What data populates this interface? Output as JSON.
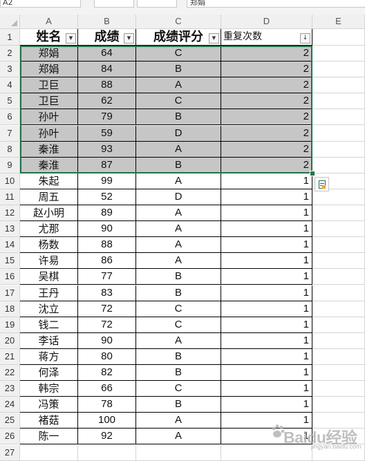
{
  "formula_bar": {
    "name_box": "A2",
    "formula": "郑娟"
  },
  "columns": [
    "A",
    "B",
    "C",
    "D",
    "E"
  ],
  "header": {
    "name": "姓名",
    "score": "成绩",
    "grade": "成绩评分",
    "repeat": "重复次数"
  },
  "rows": [
    {
      "n": "1"
    },
    {
      "n": "2",
      "name": "郑娟",
      "score": "64",
      "grade": "C",
      "repeat": "2"
    },
    {
      "n": "3",
      "name": "郑娟",
      "score": "84",
      "grade": "B",
      "repeat": "2"
    },
    {
      "n": "4",
      "name": "卫巨",
      "score": "88",
      "grade": "A",
      "repeat": "2"
    },
    {
      "n": "5",
      "name": "卫巨",
      "score": "62",
      "grade": "C",
      "repeat": "2"
    },
    {
      "n": "6",
      "name": "孙叶",
      "score": "79",
      "grade": "B",
      "repeat": "2"
    },
    {
      "n": "7",
      "name": "孙叶",
      "score": "59",
      "grade": "D",
      "repeat": "2"
    },
    {
      "n": "8",
      "name": "秦淮",
      "score": "93",
      "grade": "A",
      "repeat": "2"
    },
    {
      "n": "9",
      "name": "秦淮",
      "score": "87",
      "grade": "B",
      "repeat": "2"
    },
    {
      "n": "10",
      "name": "朱起",
      "score": "99",
      "grade": "A",
      "repeat": "1"
    },
    {
      "n": "11",
      "name": "周五",
      "score": "52",
      "grade": "D",
      "repeat": "1"
    },
    {
      "n": "12",
      "name": "赵小明",
      "score": "89",
      "grade": "A",
      "repeat": "1"
    },
    {
      "n": "13",
      "name": "尤那",
      "score": "90",
      "grade": "A",
      "repeat": "1"
    },
    {
      "n": "14",
      "name": "杨数",
      "score": "88",
      "grade": "A",
      "repeat": "1"
    },
    {
      "n": "15",
      "name": "许易",
      "score": "86",
      "grade": "A",
      "repeat": "1"
    },
    {
      "n": "16",
      "name": "吴棋",
      "score": "77",
      "grade": "B",
      "repeat": "1"
    },
    {
      "n": "17",
      "name": "王丹",
      "score": "83",
      "grade": "B",
      "repeat": "1"
    },
    {
      "n": "18",
      "name": "沈立",
      "score": "72",
      "grade": "C",
      "repeat": "1"
    },
    {
      "n": "19",
      "name": "钱二",
      "score": "72",
      "grade": "C",
      "repeat": "1"
    },
    {
      "n": "20",
      "name": "李话",
      "score": "90",
      "grade": "A",
      "repeat": "1"
    },
    {
      "n": "21",
      "name": "蒋方",
      "score": "80",
      "grade": "B",
      "repeat": "1"
    },
    {
      "n": "22",
      "name": "何泽",
      "score": "82",
      "grade": "B",
      "repeat": "1"
    },
    {
      "n": "23",
      "name": "韩宗",
      "score": "66",
      "grade": "C",
      "repeat": "1"
    },
    {
      "n": "24",
      "name": "冯策",
      "score": "78",
      "grade": "B",
      "repeat": "1"
    },
    {
      "n": "25",
      "name": "褚菇",
      "score": "100",
      "grade": "A",
      "repeat": "1"
    },
    {
      "n": "26",
      "name": "陈一",
      "score": "92",
      "grade": "A",
      "repeat": "1"
    },
    {
      "n": "27"
    }
  ],
  "watermark": {
    "main": "Baidu经验",
    "sub": "jingyan.baidu.com"
  },
  "colors": {
    "selection_border": "#217346",
    "selected_fill": "#c6c6c6"
  }
}
